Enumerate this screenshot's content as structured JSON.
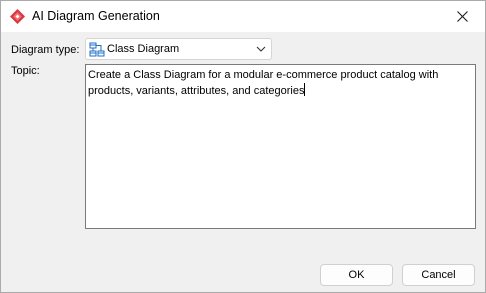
{
  "window": {
    "title": "AI Diagram Generation"
  },
  "form": {
    "diagram_type_label": "Diagram type:",
    "diagram_type_value": "Class Diagram",
    "topic_label": "Topic:",
    "topic_value": "Create a Class Diagram for a modular e-commerce product catalog with\nproducts, variants, attributes, and categories"
  },
  "buttons": {
    "ok_label": "OK",
    "cancel_label": "Cancel"
  },
  "icons": {
    "app": "visual-paradigm-logo-icon",
    "close": "close-icon",
    "diagram_type": "class-diagram-icon",
    "dropdown": "chevron-down-icon"
  },
  "colors": {
    "app_icon": "#d9363e",
    "diagram_icon": "#1f6fc5",
    "titlebar_bg": "#ffffff",
    "dialog_bg": "#f0f0f0"
  }
}
